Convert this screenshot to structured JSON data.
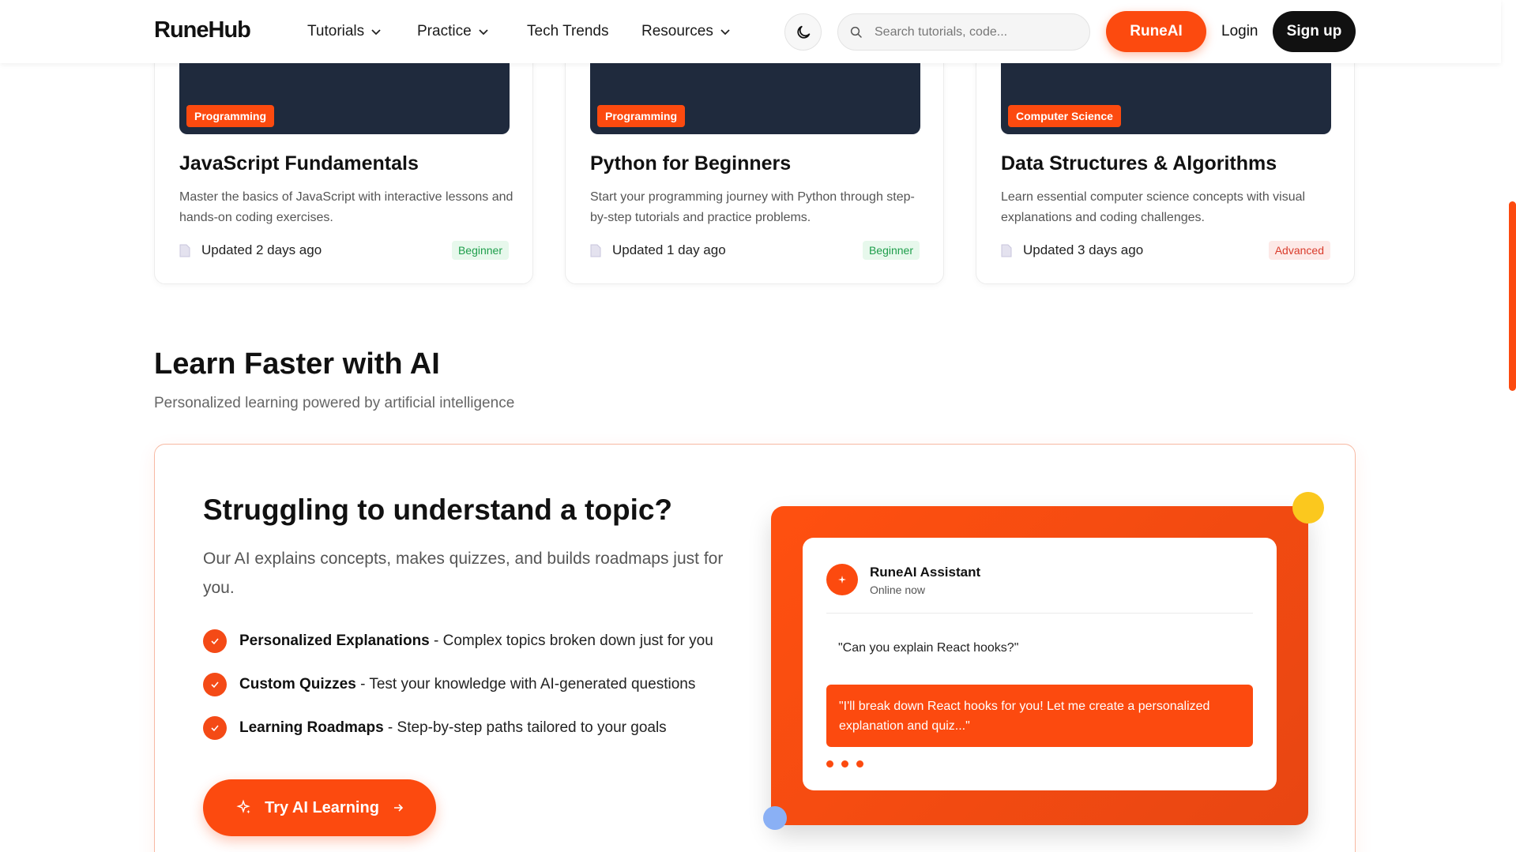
{
  "brand": {
    "logo": "RuneHub",
    "accent": "#fc4a0f"
  },
  "nav": {
    "tutorials": "Tutorials",
    "practice": "Practice",
    "tech_trends": "Tech Trends",
    "resources": "Resources"
  },
  "search": {
    "placeholder": "Search tutorials, code..."
  },
  "header": {
    "runeai": "RuneAI",
    "login": "Login",
    "signup": "Sign up"
  },
  "courses": [
    {
      "badge": "Programming",
      "title": "JavaScript Fundamentals",
      "description": "Master the basics of JavaScript with interactive lessons and hands-on coding exercises.",
      "updated": "Updated 2 days ago",
      "level": "Beginner"
    },
    {
      "badge": "Programming",
      "title": "Python for Beginners",
      "description": "Start your programming journey with Python through step-by-step tutorials and practice problems.",
      "updated": "Updated 1 day ago",
      "level": "Beginner"
    },
    {
      "badge": "Computer Science",
      "title": "Data Structures & Algorithms",
      "description": "Learn essential computer science concepts with visual explanations and coding challenges.",
      "updated": "Updated 3 days ago",
      "level": "Advanced"
    }
  ],
  "ai_section": {
    "title": "Learn Faster with AI",
    "subtitle": "Personalized learning powered by artificial intelligence",
    "heading": "Struggling to understand a topic?",
    "description": "Our AI explains concepts, makes quizzes, and builds roadmaps just for you.",
    "features": [
      {
        "name": "Personalized Explanations",
        "detail": " - Complex topics broken down just for you"
      },
      {
        "name": "Custom Quizzes",
        "detail": " - Test your knowledge with AI-generated questions"
      },
      {
        "name": "Learning Roadmaps",
        "detail": " - Step-by-step paths tailored to your goals"
      }
    ],
    "cta": "Try AI Learning"
  },
  "chat": {
    "assistant_name": "RuneAI Assistant",
    "status": "Online now",
    "question": "\"Can you explain React hooks?\"",
    "answer": "\"I'll break down React hooks for you! Let me create a personalized explanation and quiz...\""
  }
}
